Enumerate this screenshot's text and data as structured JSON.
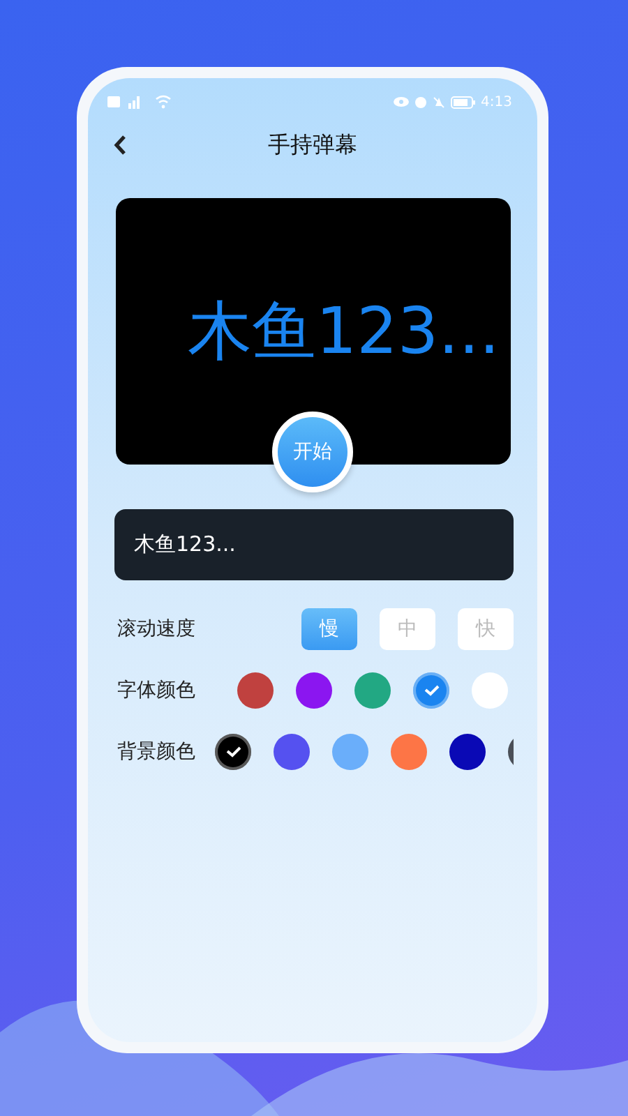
{
  "status_bar": {
    "time": "4:13"
  },
  "header": {
    "title": "手持弹幕"
  },
  "preview": {
    "text": "木鱼123..."
  },
  "start_button": {
    "label": "开始"
  },
  "input": {
    "value": "木鱼123..."
  },
  "speed": {
    "label": "滚动速度",
    "options": [
      {
        "label": "慢",
        "selected": true
      },
      {
        "label": "中",
        "selected": false
      },
      {
        "label": "快",
        "selected": false
      }
    ]
  },
  "font_color": {
    "label": "字体颜色",
    "swatches": [
      {
        "color": "#c0413f",
        "selected": false
      },
      {
        "color": "#8b16f0",
        "selected": false
      },
      {
        "color": "#22a883",
        "selected": false
      },
      {
        "color": "#1a84f0",
        "selected": true
      },
      {
        "color": "#ffffff",
        "selected": false
      }
    ]
  },
  "background_color": {
    "label": "背景颜色",
    "swatches": [
      {
        "color": "#000000",
        "selected": true
      },
      {
        "color": "#5551f0",
        "selected": false
      },
      {
        "color": "#6aaefa",
        "selected": false
      },
      {
        "color": "#fd7546",
        "selected": false
      },
      {
        "color": "#0a09b5",
        "selected": false
      },
      {
        "color": "#4a4f57",
        "selected": false
      }
    ]
  }
}
